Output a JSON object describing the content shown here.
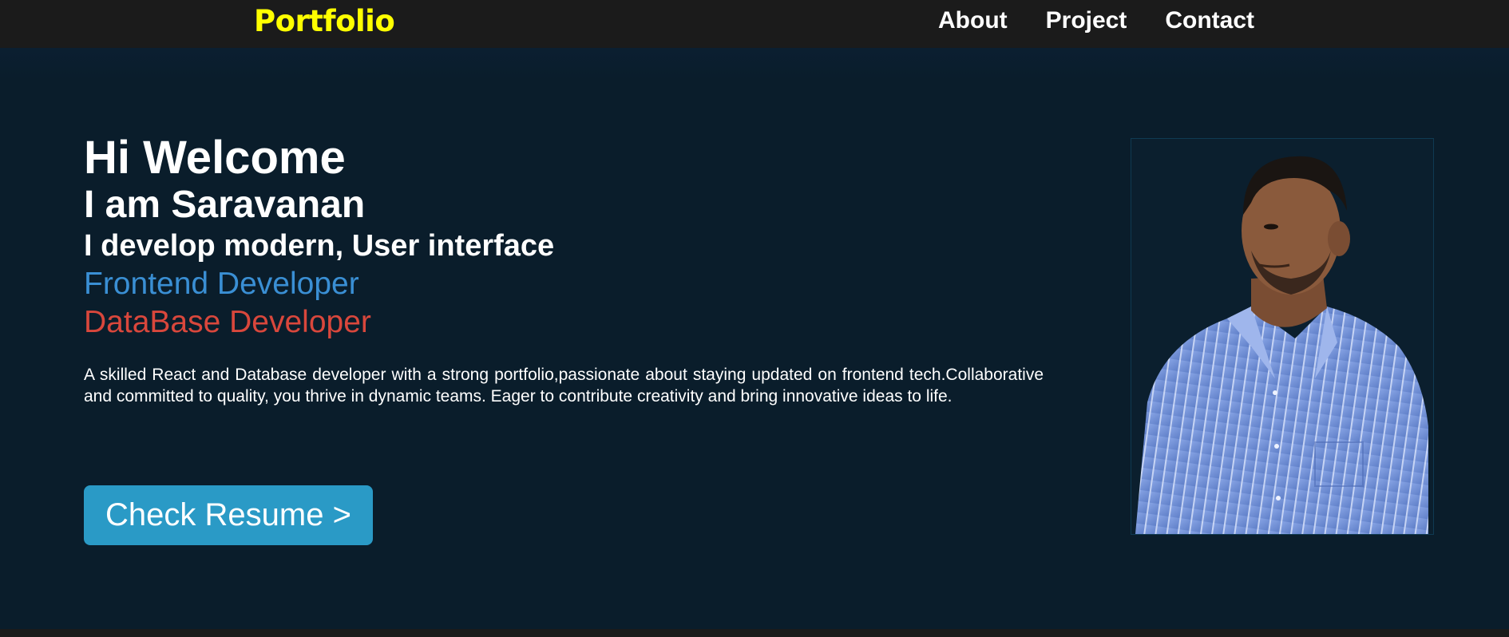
{
  "navbar": {
    "brand": "Portfolio",
    "links": [
      "About",
      "Project",
      "Contact"
    ]
  },
  "hero": {
    "welcome": "Hi Welcome",
    "name": "I am Saravanan",
    "tagline": "I develop modern, User interface",
    "role_primary": "Frontend Developer",
    "role_secondary": "DataBase Developer",
    "bio": "A skilled React and Database developer with a strong portfolio,passionate about staying updated on frontend tech.Collaborative and committed to quality, you thrive in dynamic teams. Eager to contribute creativity and bring innovative ideas to life.",
    "resume_button": "Check Resume >"
  },
  "colors": {
    "brand": "#ffff00",
    "role_primary": "#3a8fd4",
    "role_secondary": "#d9473c",
    "button": "#2a9ac6",
    "background": "#0a1d2b",
    "navbar": "#1b1b1b"
  },
  "icons": {
    "profile_photo": "person-portrait-photo"
  }
}
